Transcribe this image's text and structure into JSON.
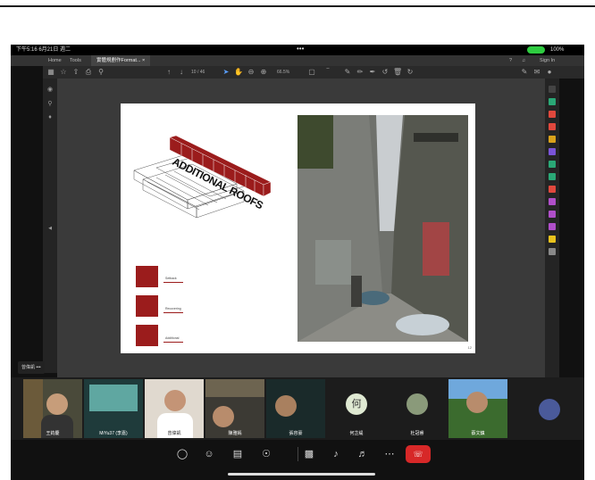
{
  "status_bar": {
    "time": "下午5:16  6月21日 週二",
    "dots": "•••",
    "battery": "100%"
  },
  "tabs": {
    "home": "Home",
    "tools": "Tools",
    "document": "實體規劃作Format...",
    "close": "×",
    "help": "?",
    "sign_in": "Sign In"
  },
  "toolbar": {
    "page_indicator": "10 / 46",
    "zoom": "66.5%"
  },
  "document_page": {
    "title_text": "ADDITIONAL ROOFS",
    "legend": [
      "Setback",
      "Recovering",
      "Additional"
    ],
    "page_number": "12"
  },
  "tooltip": {
    "name": "曾偉凱",
    "more": "•••"
  },
  "participants": [
    {
      "name": "王鈞慶",
      "type": "video",
      "bg": "#4a4a3a"
    },
    {
      "name": "MiYu37 (李嘉)",
      "type": "video",
      "bg": "#1f3b3b"
    },
    {
      "name": "曾偉凱",
      "type": "video",
      "bg": "#5a5048"
    },
    {
      "name": "陳雅嫣",
      "type": "video",
      "bg": "#3c3a34"
    },
    {
      "name": "張容豪",
      "type": "video",
      "bg": "#1a2a2a"
    },
    {
      "name": "何芷緹",
      "type": "avatar",
      "initial": "何",
      "bg": "#1c1c1c"
    },
    {
      "name": "杜冠睿",
      "type": "avatar-img",
      "bg": "#1c1c1c"
    },
    {
      "name": "蔡文鎮",
      "type": "video",
      "bg": "#3b6b2e"
    },
    {
      "name": "",
      "type": "avatar-img",
      "bg": "#1c1c1c"
    }
  ],
  "colors": {
    "accent_red": "#9b1c1c",
    "end_call": "#d72828",
    "call_green": "#2ecc40"
  },
  "icons": [
    "chat-icon",
    "people-icon",
    "share-screen-icon",
    "effects-icon",
    "video-off-icon",
    "mic-off-icon",
    "speaker-icon",
    "more-icon",
    "end-call-icon"
  ]
}
